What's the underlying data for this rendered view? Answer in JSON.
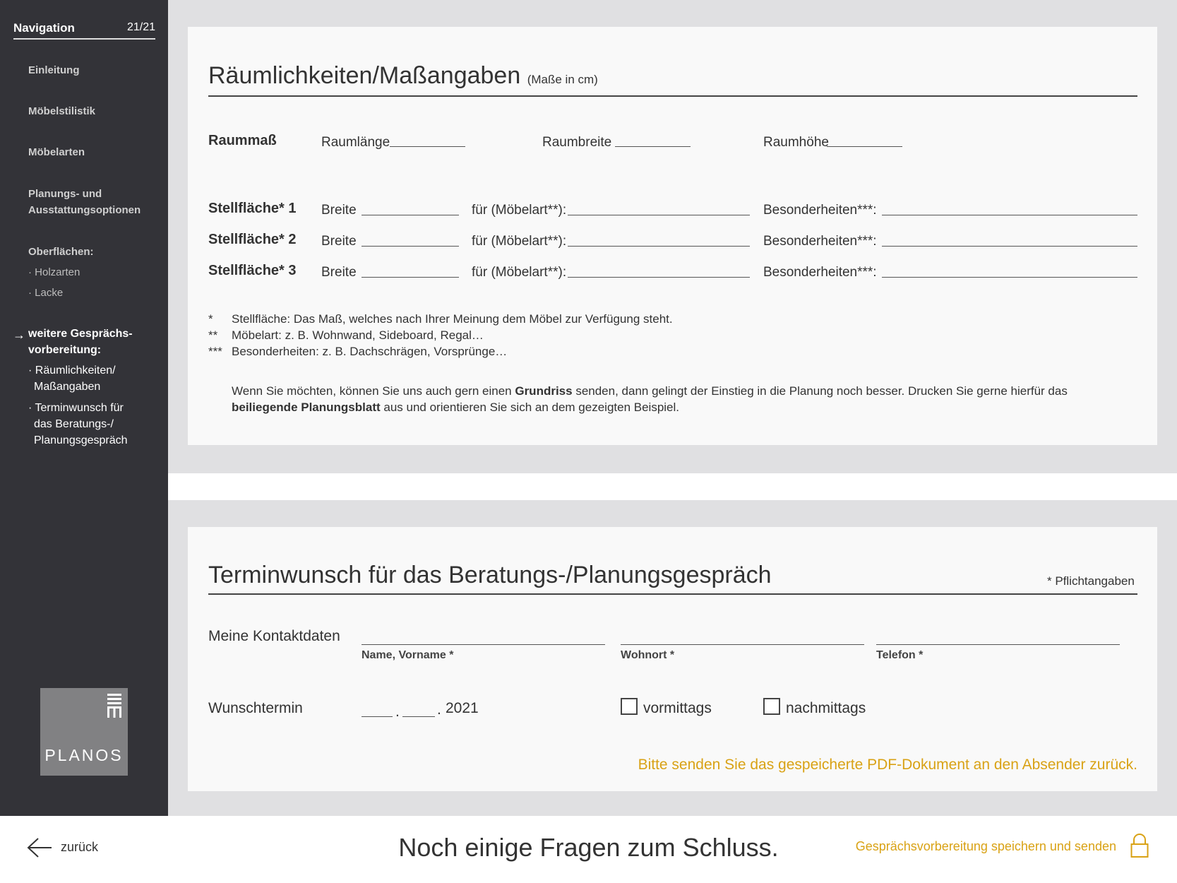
{
  "nav": {
    "title": "Navigation",
    "page_count": "21/21",
    "items": [
      {
        "label": "Einleitung"
      },
      {
        "label": "Möbelstilistik"
      },
      {
        "label": "Möbelarten"
      },
      {
        "label_line1": "Planungs- und",
        "label_line2": "Ausstattungsoptionen"
      },
      {
        "label": "Oberflächen:",
        "subitems": [
          "· Holzarten",
          "· Lacke"
        ]
      }
    ],
    "active": {
      "arrow": "→",
      "label_line1": "weitere Gesprächs-",
      "label_line2": "vorbereitung:",
      "subitems": [
        {
          "line1": "· Räumlichkeiten/",
          "line2": "Maßangaben"
        },
        {
          "line1": "· Terminwunsch für",
          "line2": "das Beratungs-/",
          "line3": "Planungsgespräch"
        }
      ]
    },
    "logo_text": "PLANOS"
  },
  "section1": {
    "title": "Räumlichkeiten/Maßangaben",
    "unit_note": "(Maße in cm)",
    "raummass": {
      "label": "Raummaß",
      "fields": [
        "Raumlänge",
        "Raumbreite",
        "Raumhöhe"
      ]
    },
    "stellflaechen": [
      {
        "label": "Stellfläche* 1",
        "breite": "Breite",
        "fuer": "für (Möbelart**):",
        "besonderheiten": "Besonderheiten***:"
      },
      {
        "label": "Stellfläche* 2",
        "breite": "Breite",
        "fuer": "für (Möbelart**):",
        "besonderheiten": "Besonderheiten***:"
      },
      {
        "label": "Stellfläche* 3",
        "breite": "Breite",
        "fuer": "für (Möbelart**):",
        "besonderheiten": "Besonderheiten***:"
      }
    ],
    "footnotes": [
      {
        "mark": "*",
        "text": "Stellfläche: Das Maß, welches nach Ihrer Meinung dem Möbel zur Verfügung steht."
      },
      {
        "mark": "**",
        "text": "Möbelart: z. B. Wohnwand, Sideboard, Regal…"
      },
      {
        "mark": "***",
        "text": "Besonderheiten: z. B. Dachschrägen, Vorsprünge…"
      }
    ],
    "note": {
      "part1": "Wenn Sie möchten, können Sie uns auch gern einen ",
      "bold1": "Grundriss",
      "part2": " senden, dann gelingt der Einstieg in die Planung noch besser. Drucken Sie gerne hierfür das",
      "bold2": "beiliegende Planungsblatt",
      "part3": " aus und orientieren Sie sich an dem gezeigten Beispiel."
    }
  },
  "section2": {
    "title": "Terminwunsch für das Beratungs-/Planungsgespräch",
    "required_note": "* Pflichtangaben",
    "contact_label": "Meine Kontaktdaten",
    "contact_fields": [
      "Name, Vorname *",
      "Wohnort *",
      "Telefon *"
    ],
    "date_label": "Wunschtermin",
    "date_sep1": ".",
    "date_sep2": ".",
    "year": "2021",
    "options": [
      "vormittags",
      "nachmittags"
    ],
    "send_note": "Bitte senden Sie das gespeicherte PDF-Dokument an den Absender zurück."
  },
  "bottom": {
    "back_label": "zurück",
    "headline": "Noch einige Fragen zum Schluss.",
    "save_send_label": "Gesprächsvorbereitung speichern und senden"
  },
  "colors": {
    "sidebar_bg": "#333338",
    "accent_yellow": "#d9a215",
    "page_bg": "#e0e0e2",
    "card_bg": "#f9f9f9"
  },
  "icons": {
    "back": "arrow-left-icon",
    "lock": "lock-icon",
    "active_nav": "arrow-right-icon"
  }
}
